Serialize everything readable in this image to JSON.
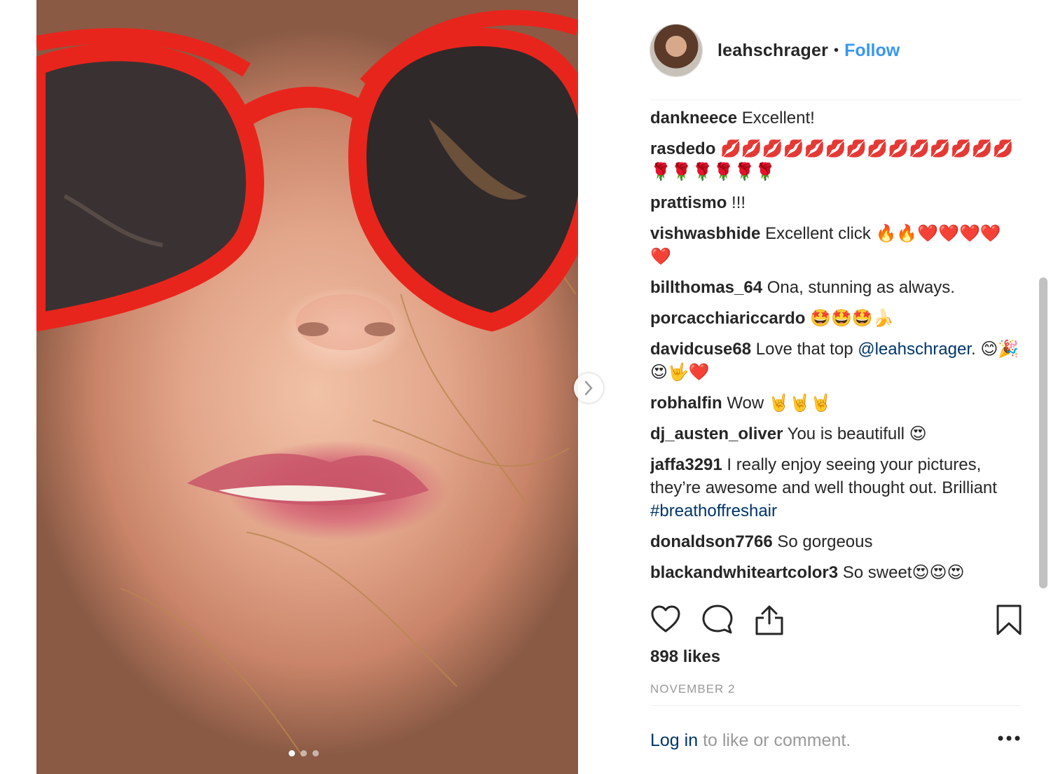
{
  "post": {
    "image_alt": "close-up face with red heart-shaped sunglasses",
    "carousel": {
      "count": 3,
      "active_index": 0
    }
  },
  "header": {
    "username": "leahschrager",
    "separator": "•",
    "follow_label": "Follow"
  },
  "comments": [
    {
      "user": "dankneece",
      "text": "Excellent!"
    },
    {
      "user": "rasdedo",
      "text": "💋💋💋💋💋💋💋💋💋💋💋💋💋💋🌹🌹🌹🌹🌹🌹"
    },
    {
      "user": "prattismo",
      "text": "!!!"
    },
    {
      "user": "vishwasbhide",
      "text": "Excellent click 🔥🔥❤️❤️❤️❤️❤️"
    },
    {
      "user": "billthomas_64",
      "text": "Ona, stunning as always."
    },
    {
      "user": "porcacchiariccardo",
      "text": "🤩🤩🤩🍌"
    },
    {
      "user": "davidcuse68",
      "text": "Love that top ",
      "mention": "@leahschrager",
      "after": ". 😊🎉😍🤟❤️"
    },
    {
      "user": "robhalfin",
      "text": "Wow 🤘🤘🤘"
    },
    {
      "user": "dj_austen_oliver",
      "text": "You is beautifull 😍"
    },
    {
      "user": "jaffa3291",
      "text": "I really enjoy seeing your pictures, they’re awesome and well thought out. Brilliant ",
      "hashtag": "#breathoffreshair"
    },
    {
      "user": "donaldson7766",
      "text": "So gorgeous"
    },
    {
      "user": "blackandwhiteartcolor3",
      "text": "So sweet😍😍😍"
    }
  ],
  "actions": {
    "like_icon": "heart-icon",
    "comment_icon": "comment-bubble-icon",
    "share_icon": "share-upload-icon",
    "save_icon": "bookmark-icon"
  },
  "likes_label": "898 likes",
  "date_label": "NOVEMBER 2",
  "footer": {
    "login_link": "Log in",
    "login_rest": " to like or comment.",
    "more_icon": "more-options-icon"
  },
  "colors": {
    "accent": "#3897f0",
    "link": "#003569",
    "text": "#262626",
    "muted": "#999999",
    "sunglasses": "#e8251c"
  }
}
